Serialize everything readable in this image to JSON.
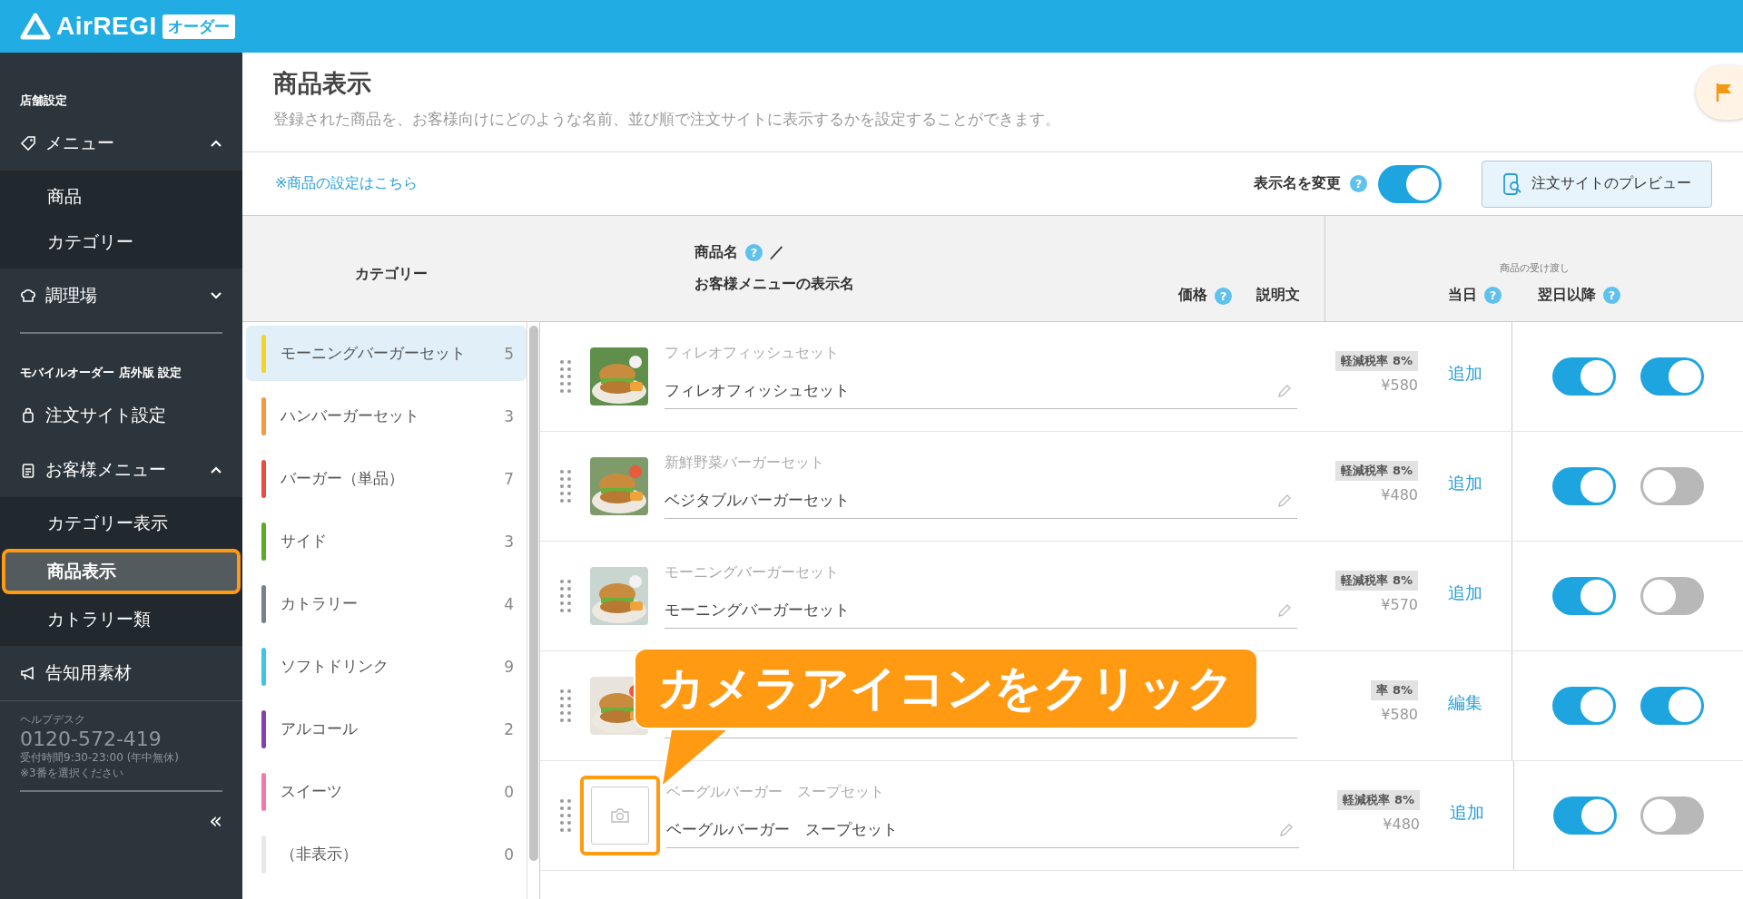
{
  "app": {
    "logo": "AirREGI",
    "badge": "オーダー"
  },
  "sidebar": {
    "sections": [
      {
        "heading": "店舗設定",
        "items": [
          {
            "label": "メニュー",
            "expanded": true,
            "children": [
              {
                "label": "商品",
                "selected": false
              },
              {
                "label": "カテゴリー",
                "selected": false
              }
            ]
          },
          {
            "label": "調理場",
            "expanded": false
          }
        ]
      },
      {
        "heading": "モバイルオーダー 店外版 設定",
        "items": [
          {
            "label": "注文サイト設定"
          },
          {
            "label": "お客様メニュー",
            "expanded": true,
            "children": [
              {
                "label": "カテゴリー表示",
                "selected": false
              },
              {
                "label": "商品表示",
                "selected": true
              },
              {
                "label": "カトラリー類",
                "selected": false
              }
            ]
          },
          {
            "label": "告知用素材"
          }
        ]
      }
    ],
    "help": {
      "title": "ヘルプデスク",
      "phone": "0120-572-419",
      "hours": "受付時間9:30-23:00 (年中無休)",
      "note": "※3番を選択ください"
    },
    "collapse": "«"
  },
  "page": {
    "title": "商品表示",
    "description": "登録された商品を、お客様向けにどのような名前、並び順で注文サイトに表示するかを設定することができます。"
  },
  "toolbar": {
    "link": "※商品の設定はこちら",
    "rename_label": "表示名を変更",
    "rename_help": "?",
    "rename_on": true,
    "preview_button": "注文サイトのプレビュー"
  },
  "table": {
    "category_header": "カテゴリー",
    "name_header": "商品名",
    "name_help": "?",
    "name_header_sep": "／",
    "display_header": "お客様メニューの表示名",
    "price_header": "価格",
    "price_help": "?",
    "desc_header": "説明文",
    "handover_header": "商品の受け渡し",
    "today_header": "当日",
    "today_help": "?",
    "later_header": "翌日以降",
    "later_help": "?"
  },
  "categories": [
    {
      "name": "モーニングバーガーセット",
      "count": "5",
      "color": "#f5d327",
      "selected": true
    },
    {
      "name": "ハンバーガーセット",
      "count": "3",
      "color": "#f39a3c",
      "selected": false
    },
    {
      "name": "バーガー（単品）",
      "count": "7",
      "color": "#ea4d3d",
      "selected": false
    },
    {
      "name": "サイド",
      "count": "3",
      "color": "#5aac23",
      "selected": false
    },
    {
      "name": "カトラリー",
      "count": "4",
      "color": "#77838a",
      "selected": false
    },
    {
      "name": "ソフトドリンク",
      "count": "9",
      "color": "#3fc5e3",
      "selected": false
    },
    {
      "name": "アルコール",
      "count": "2",
      "color": "#8a3fb0",
      "selected": false
    },
    {
      "name": "スイーツ",
      "count": "0",
      "color": "#f27aab",
      "selected": false
    },
    {
      "name": "（非表示）",
      "count": "0",
      "color": "#e6e8ea",
      "selected": false
    }
  ],
  "products": [
    {
      "kind": "picture",
      "original": "フィレオフィッシュセット",
      "display": "フィレオフィッシュセット",
      "tax": "軽減税率 8%",
      "price": "¥580",
      "desc": "追加",
      "today": true,
      "later": true
    },
    {
      "kind": "picture",
      "original": "新鮮野菜バーガーセット",
      "display": "ベジタブルバーガーセット",
      "tax": "軽減税率 8%",
      "price": "¥480",
      "desc": "追加",
      "today": true,
      "later": false
    },
    {
      "kind": "picture",
      "original": "モーニングバーガーセット",
      "display": "モーニングバーガーセット",
      "tax": "軽減税率 8%",
      "price": "¥570",
      "desc": "追加",
      "today": true,
      "later": false
    },
    {
      "kind": "picture",
      "tax": "率 8%",
      "price": "¥580",
      "desc": "編集",
      "today": true,
      "later": true
    },
    {
      "kind": "camera",
      "highlighted": true,
      "original": "ベーグルバーガー　スープセット",
      "display": "ベーグルバーガー　スープセット",
      "tax": "軽減税率 8%",
      "price": "¥480",
      "desc": "追加",
      "today": true,
      "later": false
    }
  ],
  "callout": "カメラアイコンをクリック"
}
